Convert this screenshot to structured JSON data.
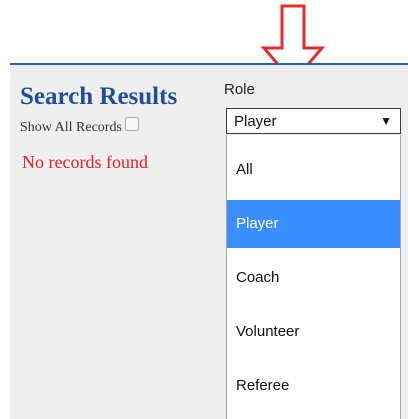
{
  "results": {
    "title": "Search Results",
    "show_all_label": "Show All Records",
    "show_all_checked": false,
    "empty_message": "No records found"
  },
  "role": {
    "label": "Role",
    "selected_value": "Player",
    "caret": "▼",
    "options": [
      "All",
      "Player",
      "Coach",
      "Volunteer",
      "Referee"
    ],
    "highlighted_option": "Player"
  },
  "colors": {
    "title": "#1f4e9e",
    "panel_border": "#2b63b3",
    "empty_message": "#e81e1e",
    "highlight": "#3a8dff",
    "arrow": "#e52b2b"
  },
  "icons": {
    "annotation": "down-arrow-icon",
    "select": "dropdown-caret-icon"
  }
}
